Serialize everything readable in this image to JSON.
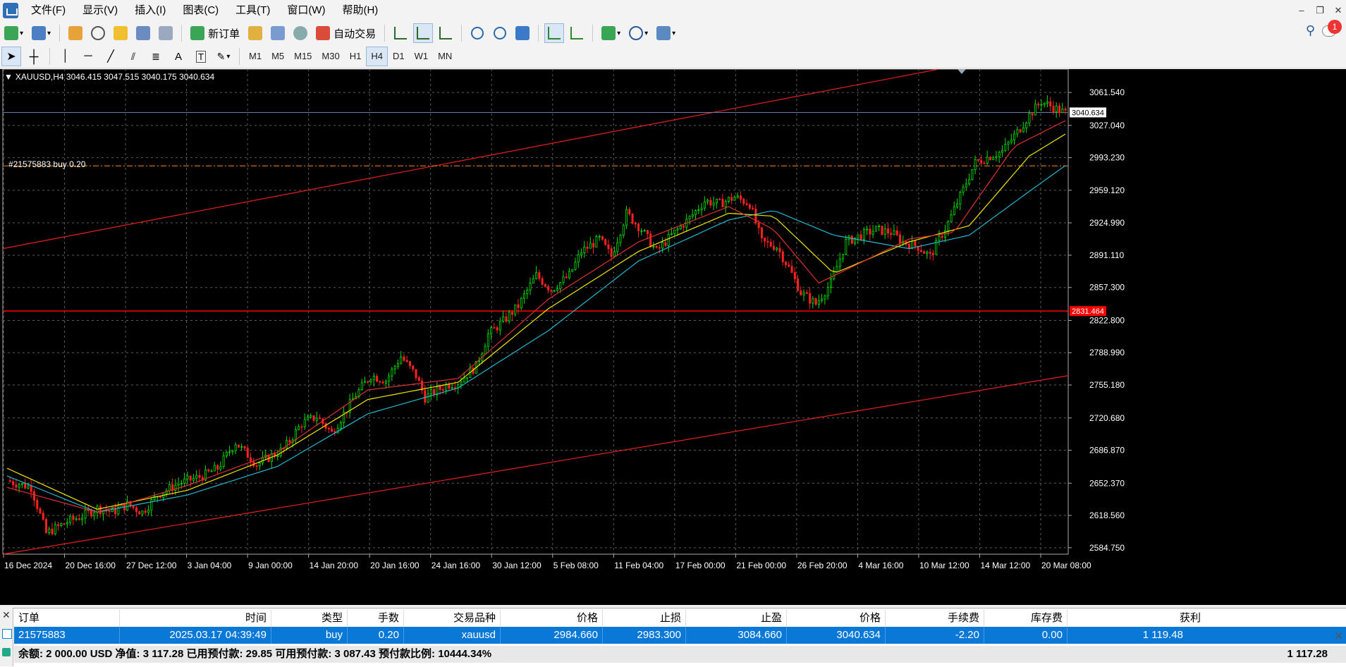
{
  "menu": [
    "文件(F)",
    "显示(V)",
    "插入(I)",
    "图表(C)",
    "工具(T)",
    "窗口(W)",
    "帮助(H)"
  ],
  "toolbar": {
    "new_order": "新订单",
    "auto_trade": "自动交易",
    "notification_count": "1"
  },
  "timeframes": [
    "M1",
    "M5",
    "M15",
    "M30",
    "H1",
    "H4",
    "D1",
    "W1",
    "MN"
  ],
  "active_timeframe": "H4",
  "chart": {
    "symbol_line": "XAUUSD,H4  3046.415 3047.515 3040.175 3040.634",
    "order_line": "#21575883 buy 0.20"
  },
  "chart_data": {
    "type": "candlestick",
    "symbol": "XAUUSD",
    "timeframe": "H4",
    "ohlc_last": {
      "open": 3046.415,
      "high": 3047.515,
      "low": 3040.175,
      "close": 3040.634
    },
    "y_ticks": [
      "3061.540",
      "3027.040",
      "2993.230",
      "2959.120",
      "2924.990",
      "2891.110",
      "2857.300",
      "2822.800",
      "2788.990",
      "2755.180",
      "2720.680",
      "2686.870",
      "2652.370",
      "2618.560",
      "2584.750"
    ],
    "y_tick_values": [
      3061.54,
      3027.04,
      2993.23,
      2959.12,
      2924.99,
      2891.11,
      2857.3,
      2822.8,
      2788.99,
      2755.18,
      2720.68,
      2686.87,
      2652.37,
      2618.56,
      2584.75
    ],
    "ylim": [
      2578,
      3086
    ],
    "x_ticks": [
      "16 Dec 2024",
      "20 Dec 16:00",
      "27 Dec 12:00",
      "3 Jan 04:00",
      "9 Jan 00:00",
      "14 Jan 20:00",
      "20 Jan 16:00",
      "24 Jan 16:00",
      "30 Jan 12:00",
      "5 Feb 08:00",
      "11 Feb 04:00",
      "17 Feb 00:00",
      "21 Feb 00:00",
      "26 Feb 20:00",
      "4 Mar 16:00",
      "10 Mar 12:00",
      "14 Mar 12:00",
      "20 Mar 08:00"
    ],
    "price_path": [
      [
        0,
        2655
      ],
      [
        8,
        2648
      ],
      [
        13,
        2600
      ],
      [
        20,
        2612
      ],
      [
        25,
        2618
      ],
      [
        30,
        2626
      ],
      [
        35,
        2622
      ],
      [
        40,
        2630
      ],
      [
        45,
        2622
      ],
      [
        50,
        2640
      ],
      [
        57,
        2652
      ],
      [
        65,
        2660
      ],
      [
        70,
        2668
      ],
      [
        76,
        2695
      ],
      [
        83,
        2672
      ],
      [
        92,
        2688
      ],
      [
        98,
        2715
      ],
      [
        103,
        2722
      ],
      [
        108,
        2705
      ],
      [
        116,
        2745
      ],
      [
        121,
        2765
      ],
      [
        126,
        2760
      ],
      [
        131,
        2785
      ],
      [
        136,
        2765
      ],
      [
        139,
        2742
      ],
      [
        146,
        2755
      ],
      [
        150,
        2758
      ],
      [
        156,
        2775
      ],
      [
        160,
        2808
      ],
      [
        165,
        2822
      ],
      [
        170,
        2838
      ],
      [
        176,
        2870
      ],
      [
        181,
        2855
      ],
      [
        187,
        2870
      ],
      [
        191,
        2895
      ],
      [
        197,
        2908
      ],
      [
        201,
        2890
      ],
      [
        206,
        2935
      ],
      [
        211,
        2918
      ],
      [
        216,
        2895
      ],
      [
        221,
        2912
      ],
      [
        227,
        2930
      ],
      [
        232,
        2948
      ],
      [
        237,
        2945
      ],
      [
        242,
        2952
      ],
      [
        247,
        2945
      ],
      [
        251,
        2905
      ],
      [
        256,
        2900
      ],
      [
        260,
        2878
      ],
      [
        264,
        2852
      ],
      [
        269,
        2840
      ],
      [
        274,
        2862
      ],
      [
        279,
        2905
      ],
      [
        284,
        2912
      ],
      [
        289,
        2918
      ],
      [
        294,
        2915
      ],
      [
        298,
        2905
      ],
      [
        303,
        2900
      ],
      [
        307,
        2890
      ],
      [
        313,
        2925
      ],
      [
        318,
        2960
      ],
      [
        322,
        2988
      ],
      [
        327,
        2995
      ],
      [
        331,
        3000
      ],
      [
        336,
        3020
      ],
      [
        340,
        3038
      ],
      [
        344,
        3052
      ],
      [
        348,
        3046
      ],
      [
        352,
        3040
      ]
    ],
    "ma_fast": [
      [
        0,
        2648
      ],
      [
        30,
        2622
      ],
      [
        60,
        2650
      ],
      [
        90,
        2685
      ],
      [
        120,
        2750
      ],
      [
        150,
        2762
      ],
      [
        180,
        2845
      ],
      [
        210,
        2905
      ],
      [
        240,
        2942
      ],
      [
        255,
        2918
      ],
      [
        270,
        2862
      ],
      [
        300,
        2908
      ],
      [
        315,
        2915
      ],
      [
        335,
        3005
      ],
      [
        352,
        3032
      ]
    ],
    "ma_mid": [
      [
        0,
        2668
      ],
      [
        30,
        2625
      ],
      [
        60,
        2645
      ],
      [
        90,
        2682
      ],
      [
        120,
        2740
      ],
      [
        150,
        2758
      ],
      [
        180,
        2835
      ],
      [
        210,
        2895
      ],
      [
        240,
        2935
      ],
      [
        255,
        2932
      ],
      [
        275,
        2872
      ],
      [
        300,
        2905
      ],
      [
        320,
        2922
      ],
      [
        340,
        2995
      ],
      [
        352,
        3018
      ]
    ],
    "ma_slow": [
      [
        0,
        2660
      ],
      [
        30,
        2622
      ],
      [
        60,
        2640
      ],
      [
        90,
        2670
      ],
      [
        120,
        2725
      ],
      [
        150,
        2752
      ],
      [
        180,
        2812
      ],
      [
        210,
        2885
      ],
      [
        240,
        2928
      ],
      [
        255,
        2938
      ],
      [
        275,
        2912
      ],
      [
        300,
        2898
      ],
      [
        320,
        2912
      ],
      [
        340,
        2958
      ],
      [
        352,
        2985
      ]
    ],
    "channel_upper": [
      [
        0,
        2898
      ],
      [
        310,
        3086
      ]
    ],
    "channel_lower": [
      [
        0,
        2578
      ],
      [
        352,
        2765
      ]
    ],
    "hlines": [
      {
        "price": 3040.634,
        "label": "3040.634",
        "color": "#5f7fa8"
      },
      {
        "price": 2984.66,
        "label": "",
        "color": "#ff8a00"
      },
      {
        "price": 2832.6,
        "label": "2831.464",
        "color": "#ff0000"
      }
    ]
  },
  "terminal": {
    "columns": [
      "订单",
      "时间",
      "类型",
      "手数",
      "交易品种",
      "价格",
      "止损",
      "止盈",
      "价格",
      "手续费",
      "库存费",
      "获利"
    ],
    "row": [
      "21575883",
      "2025.03.17 04:39:49",
      "buy",
      "0.20",
      "xauusd",
      "2984.660",
      "2983.300",
      "3084.660",
      "3040.634",
      "-2.20",
      "0.00",
      "1 119.48"
    ],
    "footer": "余额: 2 000.00 USD  净值: 3 117.28  已用预付款: 29.85  可用预付款: 3 087.43  预付款比例: 10444.34%",
    "footer_profit": "1 117.28"
  }
}
